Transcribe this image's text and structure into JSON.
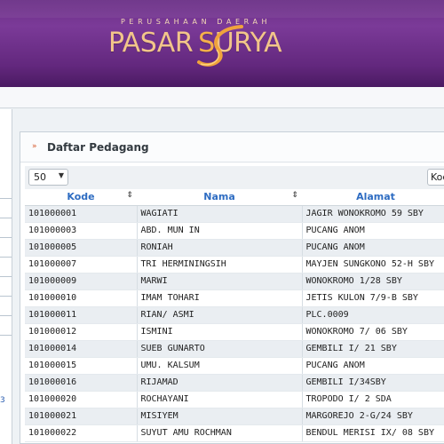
{
  "header": {
    "subtitle": "PERUSAHAAN DAERAH",
    "brand": "PASAR SURYA",
    "brand_left": "PASAR",
    "brand_s": "S",
    "brand_right": "URYA",
    "colors": {
      "header": "#6a2f86",
      "brand_text": "#f2c58a"
    }
  },
  "sidebar": {
    "mark": "3"
  },
  "panel": {
    "title": "Daftar Pedagang",
    "title_icon": "double-chevron-right-icon",
    "page_size": "50",
    "search_select": "Kode"
  },
  "table": {
    "columns": [
      "Kode",
      "Nama",
      "Alamat"
    ],
    "rows": [
      [
        "101000001",
        "WAGIATI",
        "JAGIR WONOKROMO 59 SBY"
      ],
      [
        "101000003",
        "ABD. MUN IN",
        "PUCANG ANOM"
      ],
      [
        "101000005",
        "RONIAH",
        "PUCANG ANOM"
      ],
      [
        "101000007",
        "TRI HERMININGSIH",
        "MAYJEN SUNGKONO 52-H SBY"
      ],
      [
        "101000009",
        "MARWI",
        "WONOKROMO 1/28 SBY"
      ],
      [
        "101000010",
        "IMAM TOHARI",
        "JETIS KULON 7/9-B SBY"
      ],
      [
        "101000011",
        "RIAN/ ASMI",
        "PLC.0009"
      ],
      [
        "101000012",
        "ISMINI",
        "WONOKROMO 7/ 06 SBY"
      ],
      [
        "101000014",
        "SUEB GUNARTO",
        "GEMBILI I/ 21 SBY"
      ],
      [
        "101000015",
        "UMU. KALSUM",
        "PUCANG ANOM"
      ],
      [
        "101000016",
        "RIJAMAD",
        "GEMBILI I/34SBY"
      ],
      [
        "101000020",
        "ROCHAYANI",
        "TROPODO I/ 2 SDA"
      ],
      [
        "101000021",
        "MISIYEM",
        "MARGOREJO 2-G/24 SBY"
      ],
      [
        "101000022",
        "SUYUT AMU ROCHMAN",
        "BENDUL MERISI IX/ 08 SBY"
      ]
    ]
  }
}
